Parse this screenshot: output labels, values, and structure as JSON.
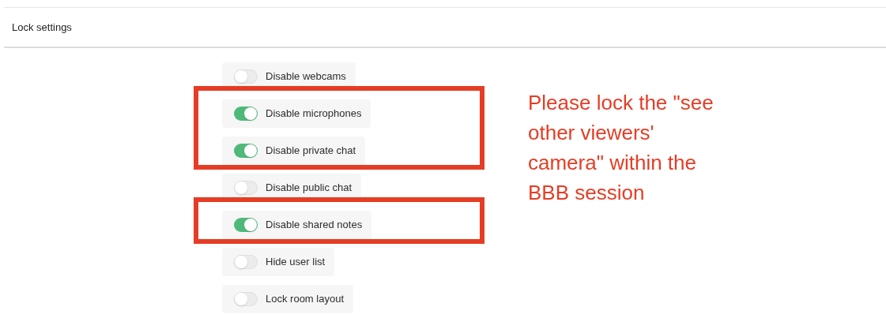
{
  "panel": {
    "title": "Lock settings"
  },
  "settings": [
    {
      "label": "Disable webcams",
      "on": false,
      "highlighted": false
    },
    {
      "label": "Disable microphones",
      "on": true,
      "highlighted": true
    },
    {
      "label": "Disable private chat",
      "on": true,
      "highlighted": true
    },
    {
      "label": "Disable public chat",
      "on": false,
      "highlighted": false
    },
    {
      "label": "Disable shared notes",
      "on": true,
      "highlighted": true
    },
    {
      "label": "Hide user list",
      "on": false,
      "highlighted": false
    },
    {
      "label": "Lock room layout",
      "on": false,
      "highlighted": false
    }
  ],
  "annotation": {
    "text": "Please lock the \"see other viewers' camera\" within the BBB session"
  }
}
